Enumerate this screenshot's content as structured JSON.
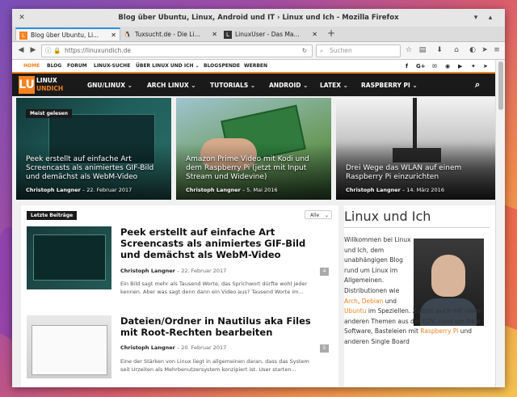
{
  "window": {
    "title": "Blog über Ubuntu, Linux, Android und IT › Linux und Ich - Mozilla Firefox"
  },
  "tabs": [
    {
      "label": "Blog über Ubuntu, Li...",
      "active": true
    },
    {
      "label": "Tuxsucht.de - Die Li...",
      "active": false
    },
    {
      "label": "LinuxUser - Das Ma...",
      "active": false
    }
  ],
  "urlbar": {
    "url": "https://linuxundich.de",
    "search_placeholder": "Suchen"
  },
  "colors": {
    "accent": "#f58220",
    "nav_bg": "#1a1a1a"
  },
  "site": {
    "topnav": [
      "HOME",
      "BLOG",
      "FORUM",
      "LINUX-SUCHE",
      "ÜBER LINUX UND ICH ⌄",
      "BLOGSPENDE",
      "WERBEN"
    ],
    "logo_line1": "LINUX",
    "logo_line2": "UNDICH",
    "mainnav": [
      "GNU/LINUX ⌄",
      "ARCH LINUX ⌄",
      "TUTORIALS ⌄",
      "ANDROID ⌄",
      "LATEX ⌄",
      "RASPBERRY PI ⌄"
    ]
  },
  "hero": {
    "badge": "Meist gelesen",
    "items": [
      {
        "title": "Peek erstellt auf einfache Art Screencasts als animiertes GIF-Bild und demächst als WebM-Video",
        "author": "Christoph Langner",
        "date": "22. Februar 2017"
      },
      {
        "title": "Amazon Prime Video mit Kodi und dem Raspberry Pi (jetzt mit Input Stream und Widevine)",
        "author": "Christoph Langner",
        "date": "5. Mai 2016"
      },
      {
        "title": "Drei Wege das WLAN auf einem Raspberry Pi einzurichten",
        "author": "Christoph Langner",
        "date": "14. März 2016"
      }
    ]
  },
  "list": {
    "badge": "Letzte Beiträge",
    "filter": "Alle",
    "posts": [
      {
        "title": "Peek erstellt auf einfache Art Screencasts als animiertes GIF-Bild und demächst als WebM-Video",
        "author": "Christoph Langner",
        "date": "22. Februar 2017",
        "excerpt": "Ein Bild sagt mehr als Tausend Worte, das Sprichwort dürfte wohl jeder kennen. Aber was sagt denn dann ein Video aus? Tausend Worte im...",
        "comments": "4"
      },
      {
        "title": "Dateien/Ordner in Nautilus aka Files mit Root-Rechten bearbeiten",
        "author": "Christoph Langner",
        "date": "20. Februar 2017",
        "excerpt": "Eine der Stärken von Linux liegt in allgemeinen daran, dass das System seit Urzeiten als Mehrbenutzersystem konzipiert ist. User starten...",
        "comments": "5"
      }
    ]
  },
  "sidebar": {
    "title": "Linux und Ich",
    "text_intro": "Willkommen bei Linux und Ich, dem unabhängigen Blog rund um Linux im Allgemeinen. Distributionen wie",
    "link_arch": "Arch",
    "link_debian": "Debian",
    "link_ubuntu": "Ubuntu",
    "text_mid": "im Speziellen. Zudem auch mit vielen anderen Themen aus der EDV, rund um freie Software, Basteleien mit",
    "link_rpi": "Raspberry Pi",
    "text_end": "und anderen Single Board"
  }
}
